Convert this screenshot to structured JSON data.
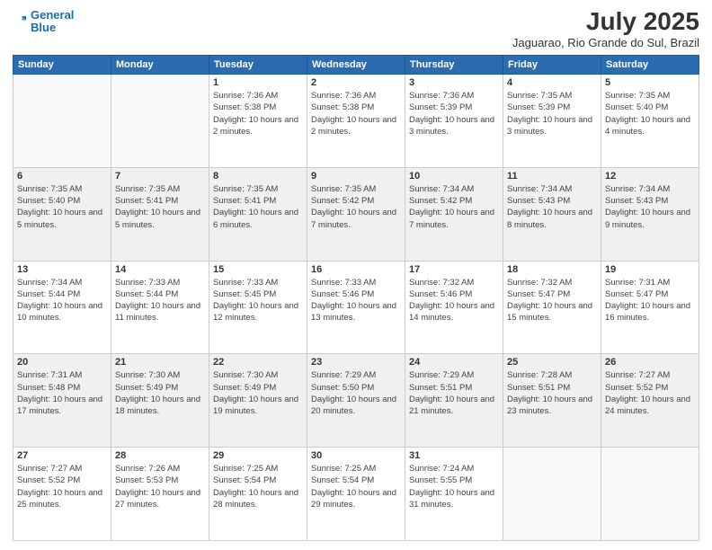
{
  "header": {
    "logo_line1": "General",
    "logo_line2": "Blue",
    "month_year": "July 2025",
    "location": "Jaguarao, Rio Grande do Sul, Brazil"
  },
  "weekdays": [
    "Sunday",
    "Monday",
    "Tuesday",
    "Wednesday",
    "Thursday",
    "Friday",
    "Saturday"
  ],
  "weeks": [
    [
      {
        "day": "",
        "info": ""
      },
      {
        "day": "",
        "info": ""
      },
      {
        "day": "1",
        "info": "Sunrise: 7:36 AM\nSunset: 5:38 PM\nDaylight: 10 hours and 2 minutes."
      },
      {
        "day": "2",
        "info": "Sunrise: 7:36 AM\nSunset: 5:38 PM\nDaylight: 10 hours and 2 minutes."
      },
      {
        "day": "3",
        "info": "Sunrise: 7:36 AM\nSunset: 5:39 PM\nDaylight: 10 hours and 3 minutes."
      },
      {
        "day": "4",
        "info": "Sunrise: 7:35 AM\nSunset: 5:39 PM\nDaylight: 10 hours and 3 minutes."
      },
      {
        "day": "5",
        "info": "Sunrise: 7:35 AM\nSunset: 5:40 PM\nDaylight: 10 hours and 4 minutes."
      }
    ],
    [
      {
        "day": "6",
        "info": "Sunrise: 7:35 AM\nSunset: 5:40 PM\nDaylight: 10 hours and 5 minutes."
      },
      {
        "day": "7",
        "info": "Sunrise: 7:35 AM\nSunset: 5:41 PM\nDaylight: 10 hours and 5 minutes."
      },
      {
        "day": "8",
        "info": "Sunrise: 7:35 AM\nSunset: 5:41 PM\nDaylight: 10 hours and 6 minutes."
      },
      {
        "day": "9",
        "info": "Sunrise: 7:35 AM\nSunset: 5:42 PM\nDaylight: 10 hours and 7 minutes."
      },
      {
        "day": "10",
        "info": "Sunrise: 7:34 AM\nSunset: 5:42 PM\nDaylight: 10 hours and 7 minutes."
      },
      {
        "day": "11",
        "info": "Sunrise: 7:34 AM\nSunset: 5:43 PM\nDaylight: 10 hours and 8 minutes."
      },
      {
        "day": "12",
        "info": "Sunrise: 7:34 AM\nSunset: 5:43 PM\nDaylight: 10 hours and 9 minutes."
      }
    ],
    [
      {
        "day": "13",
        "info": "Sunrise: 7:34 AM\nSunset: 5:44 PM\nDaylight: 10 hours and 10 minutes."
      },
      {
        "day": "14",
        "info": "Sunrise: 7:33 AM\nSunset: 5:44 PM\nDaylight: 10 hours and 11 minutes."
      },
      {
        "day": "15",
        "info": "Sunrise: 7:33 AM\nSunset: 5:45 PM\nDaylight: 10 hours and 12 minutes."
      },
      {
        "day": "16",
        "info": "Sunrise: 7:33 AM\nSunset: 5:46 PM\nDaylight: 10 hours and 13 minutes."
      },
      {
        "day": "17",
        "info": "Sunrise: 7:32 AM\nSunset: 5:46 PM\nDaylight: 10 hours and 14 minutes."
      },
      {
        "day": "18",
        "info": "Sunrise: 7:32 AM\nSunset: 5:47 PM\nDaylight: 10 hours and 15 minutes."
      },
      {
        "day": "19",
        "info": "Sunrise: 7:31 AM\nSunset: 5:47 PM\nDaylight: 10 hours and 16 minutes."
      }
    ],
    [
      {
        "day": "20",
        "info": "Sunrise: 7:31 AM\nSunset: 5:48 PM\nDaylight: 10 hours and 17 minutes."
      },
      {
        "day": "21",
        "info": "Sunrise: 7:30 AM\nSunset: 5:49 PM\nDaylight: 10 hours and 18 minutes."
      },
      {
        "day": "22",
        "info": "Sunrise: 7:30 AM\nSunset: 5:49 PM\nDaylight: 10 hours and 19 minutes."
      },
      {
        "day": "23",
        "info": "Sunrise: 7:29 AM\nSunset: 5:50 PM\nDaylight: 10 hours and 20 minutes."
      },
      {
        "day": "24",
        "info": "Sunrise: 7:29 AM\nSunset: 5:51 PM\nDaylight: 10 hours and 21 minutes."
      },
      {
        "day": "25",
        "info": "Sunrise: 7:28 AM\nSunset: 5:51 PM\nDaylight: 10 hours and 23 minutes."
      },
      {
        "day": "26",
        "info": "Sunrise: 7:27 AM\nSunset: 5:52 PM\nDaylight: 10 hours and 24 minutes."
      }
    ],
    [
      {
        "day": "27",
        "info": "Sunrise: 7:27 AM\nSunset: 5:52 PM\nDaylight: 10 hours and 25 minutes."
      },
      {
        "day": "28",
        "info": "Sunrise: 7:26 AM\nSunset: 5:53 PM\nDaylight: 10 hours and 27 minutes."
      },
      {
        "day": "29",
        "info": "Sunrise: 7:25 AM\nSunset: 5:54 PM\nDaylight: 10 hours and 28 minutes."
      },
      {
        "day": "30",
        "info": "Sunrise: 7:25 AM\nSunset: 5:54 PM\nDaylight: 10 hours and 29 minutes."
      },
      {
        "day": "31",
        "info": "Sunrise: 7:24 AM\nSunset: 5:55 PM\nDaylight: 10 hours and 31 minutes."
      },
      {
        "day": "",
        "info": ""
      },
      {
        "day": "",
        "info": ""
      }
    ]
  ]
}
